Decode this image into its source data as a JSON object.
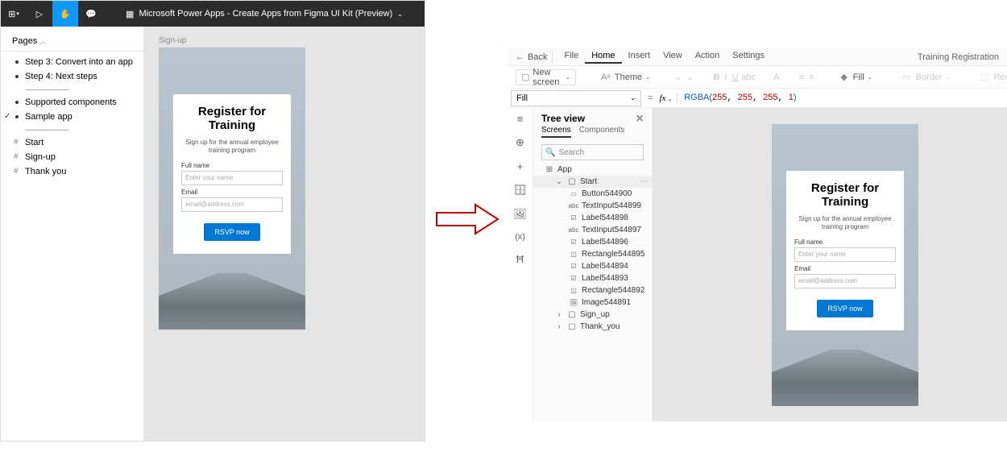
{
  "figma": {
    "title": "Microsoft Power Apps - Create Apps from Figma UI Kit (Preview)",
    "pages_label": "Pages",
    "items": [
      {
        "label": "Step 3: Convert into an app",
        "type": "dot"
      },
      {
        "label": "Step 4: Next steps",
        "type": "dot"
      },
      {
        "type": "dash"
      },
      {
        "label": "Supported components",
        "type": "dot"
      },
      {
        "label": "Sample app",
        "type": "dot",
        "checked": true
      },
      {
        "type": "dash"
      }
    ],
    "frames": [
      {
        "label": "Start"
      },
      {
        "label": "Sign-up"
      },
      {
        "label": "Thank you"
      }
    ],
    "artboard_label": "Sign-up"
  },
  "registration": {
    "heading1": "Register for",
    "heading2": "Training",
    "sub": "Sign up for the annual employee training program",
    "fullname_label": "Full name",
    "fullname_placeholder": "Enter your name",
    "email_label": "Email",
    "email_placeholder": "email@address.com",
    "button": "RSVP now"
  },
  "powerapps": {
    "back": "Back",
    "menu": [
      "File",
      "Home",
      "Insert",
      "View",
      "Action",
      "Settings"
    ],
    "active_menu": "Home",
    "app_name": "Training Registration",
    "ribbon": {
      "new_screen": "New screen",
      "theme": "Theme",
      "fill": "Fill",
      "border": "Border",
      "reord": "Reord"
    },
    "property": "Fill",
    "formula": {
      "fn": "RGBA",
      "args": [
        "255",
        "255",
        "255",
        "1"
      ]
    },
    "tree": {
      "title": "Tree view",
      "tabs": [
        "Screens",
        "Components"
      ],
      "search_placeholder": "Search",
      "app": "App",
      "screens": [
        {
          "name": "Start",
          "expanded": true,
          "selected": true,
          "children": [
            {
              "name": "Button544900",
              "icon": "btn"
            },
            {
              "name": "TextInput544899",
              "icon": "txt"
            },
            {
              "name": "Label544898",
              "icon": "lbl"
            },
            {
              "name": "TextInput544897",
              "icon": "txt"
            },
            {
              "name": "Label544896",
              "icon": "lbl"
            },
            {
              "name": "Rectangle544895",
              "icon": "rect"
            },
            {
              "name": "Label544894",
              "icon": "lbl"
            },
            {
              "name": "Label544893",
              "icon": "lbl"
            },
            {
              "name": "Rectangle544892",
              "icon": "rect"
            },
            {
              "name": "Image544891",
              "icon": "img"
            }
          ]
        },
        {
          "name": "Sign_up",
          "expanded": false
        },
        {
          "name": "Thank_you",
          "expanded": false
        }
      ]
    }
  }
}
